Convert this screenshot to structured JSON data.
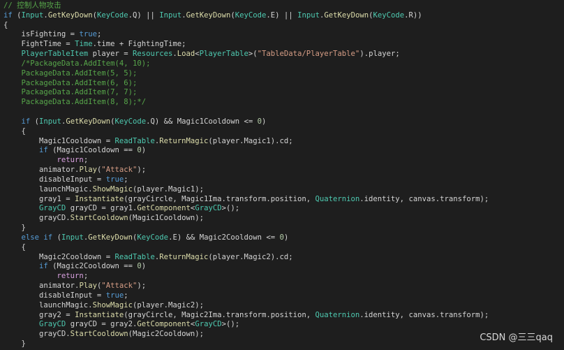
{
  "colors": {
    "background": "#1e1e1e",
    "plain": "#d4d4d4",
    "keyword": "#569cd6",
    "control": "#d8a0df",
    "type": "#4ec9b0",
    "method": "#dcdcaa",
    "string": "#d69d85",
    "number": "#b5cea8",
    "comment": "#57a64a",
    "field": "#dcdcdc"
  },
  "editor": {
    "lines": [
      [
        [
          "// 控制人物攻击",
          "comment"
        ]
      ],
      [
        [
          "if",
          "keyword"
        ],
        [
          " (",
          ""
        ],
        [
          "Input",
          "type"
        ],
        [
          ".",
          ""
        ],
        [
          "GetKeyDown",
          "method"
        ],
        [
          "(",
          ""
        ],
        [
          "KeyCode",
          "type"
        ],
        [
          ".Q) || ",
          ""
        ],
        [
          "Input",
          "type"
        ],
        [
          ".",
          ""
        ],
        [
          "GetKeyDown",
          "method"
        ],
        [
          "(",
          ""
        ],
        [
          "KeyCode",
          "type"
        ],
        [
          ".E) || ",
          ""
        ],
        [
          "Input",
          "type"
        ],
        [
          ".",
          ""
        ],
        [
          "GetKeyDown",
          "method"
        ],
        [
          "(",
          ""
        ],
        [
          "KeyCode",
          "type"
        ],
        [
          ".R))",
          ""
        ]
      ],
      [
        [
          "{",
          ""
        ]
      ],
      [
        [
          "    isFighting = ",
          ""
        ],
        [
          "true",
          "keyword"
        ],
        [
          ";",
          ""
        ]
      ],
      [
        [
          "    FightTime = ",
          ""
        ],
        [
          "Time",
          "type"
        ],
        [
          ".time + FightingTime;",
          ""
        ]
      ],
      [
        [
          "    ",
          ""
        ],
        [
          "PlayerTableItem",
          "type"
        ],
        [
          " player = ",
          ""
        ],
        [
          "Resources",
          "type"
        ],
        [
          ".",
          ""
        ],
        [
          "Load",
          "method"
        ],
        [
          "<",
          ""
        ],
        [
          "PlayerTable",
          "type"
        ],
        [
          ">(",
          ""
        ],
        [
          "\"TableData/PlayerTable\"",
          "string"
        ],
        [
          ").player;",
          ""
        ]
      ],
      [
        [
          "    /*PackageData.AddItem(4, 10);",
          "comment"
        ]
      ],
      [
        [
          "    PackageData.AddItem(5, 5);",
          "comment"
        ]
      ],
      [
        [
          "    PackageData.AddItem(6, 6);",
          "comment"
        ]
      ],
      [
        [
          "    PackageData.AddItem(7, 7);",
          "comment"
        ]
      ],
      [
        [
          "    PackageData.AddItem(8, 8);*/",
          "comment"
        ]
      ],
      [
        [
          "",
          ""
        ]
      ],
      [
        [
          "    ",
          ""
        ],
        [
          "if",
          "keyword"
        ],
        [
          " (",
          ""
        ],
        [
          "Input",
          "type"
        ],
        [
          ".",
          ""
        ],
        [
          "GetKeyDown",
          "method"
        ],
        [
          "(",
          ""
        ],
        [
          "KeyCode",
          "type"
        ],
        [
          ".Q) && Magic1Cooldown <= ",
          ""
        ],
        [
          "0",
          "number"
        ],
        [
          ")",
          ""
        ]
      ],
      [
        [
          "    {",
          ""
        ]
      ],
      [
        [
          "        Magic1Cooldown = ",
          ""
        ],
        [
          "ReadTable",
          "type"
        ],
        [
          ".",
          ""
        ],
        [
          "ReturnMagic",
          "method"
        ],
        [
          "(player.Magic1).cd;",
          ""
        ]
      ],
      [
        [
          "        ",
          ""
        ],
        [
          "if",
          "keyword"
        ],
        [
          " (Magic1Cooldown == ",
          ""
        ],
        [
          "0",
          "number"
        ],
        [
          ")",
          ""
        ]
      ],
      [
        [
          "            ",
          ""
        ],
        [
          "return",
          "control"
        ],
        [
          ";",
          ""
        ]
      ],
      [
        [
          "        animator.",
          ""
        ],
        [
          "Play",
          "method"
        ],
        [
          "(",
          ""
        ],
        [
          "\"Attack\"",
          "string"
        ],
        [
          ");",
          ""
        ]
      ],
      [
        [
          "        disableInput = ",
          ""
        ],
        [
          "true",
          "keyword"
        ],
        [
          ";",
          ""
        ]
      ],
      [
        [
          "        launchMagic.",
          ""
        ],
        [
          "ShowMagic",
          "method"
        ],
        [
          "(player.Magic1);",
          ""
        ]
      ],
      [
        [
          "        gray1 = ",
          ""
        ],
        [
          "Instantiate",
          "method"
        ],
        [
          "(grayCircle, Magic1Ima.transform.position, ",
          ""
        ],
        [
          "Quaternion",
          "type"
        ],
        [
          ".identity, canvas.transform);",
          ""
        ]
      ],
      [
        [
          "        ",
          ""
        ],
        [
          "GrayCD",
          "type"
        ],
        [
          " grayCD = gray1.",
          ""
        ],
        [
          "GetComponent",
          "method"
        ],
        [
          "<",
          ""
        ],
        [
          "GrayCD",
          "type"
        ],
        [
          ">();",
          ""
        ]
      ],
      [
        [
          "        grayCD.",
          ""
        ],
        [
          "StartCooldown",
          "method"
        ],
        [
          "(Magic1Cooldown);",
          ""
        ]
      ],
      [
        [
          "    }",
          ""
        ]
      ],
      [
        [
          "    ",
          ""
        ],
        [
          "else",
          "keyword"
        ],
        [
          " ",
          ""
        ],
        [
          "if",
          "keyword"
        ],
        [
          " (",
          ""
        ],
        [
          "Input",
          "type"
        ],
        [
          ".",
          ""
        ],
        [
          "GetKeyDown",
          "method"
        ],
        [
          "(",
          ""
        ],
        [
          "KeyCode",
          "type"
        ],
        [
          ".E) && Magic2Cooldown <= ",
          ""
        ],
        [
          "0",
          "number"
        ],
        [
          ")",
          ""
        ]
      ],
      [
        [
          "    {",
          ""
        ]
      ],
      [
        [
          "        Magic2Cooldown = ",
          ""
        ],
        [
          "ReadTable",
          "type"
        ],
        [
          ".",
          ""
        ],
        [
          "ReturnMagic",
          "method"
        ],
        [
          "(player.Magic2).cd;",
          ""
        ]
      ],
      [
        [
          "        ",
          ""
        ],
        [
          "if",
          "keyword"
        ],
        [
          " (Magic2Cooldown == ",
          ""
        ],
        [
          "0",
          "number"
        ],
        [
          ")",
          ""
        ]
      ],
      [
        [
          "            ",
          ""
        ],
        [
          "return",
          "control"
        ],
        [
          ";",
          ""
        ]
      ],
      [
        [
          "        animator.",
          ""
        ],
        [
          "Play",
          "method"
        ],
        [
          "(",
          ""
        ],
        [
          "\"Attack\"",
          "string"
        ],
        [
          ");",
          ""
        ]
      ],
      [
        [
          "        disableInput = ",
          ""
        ],
        [
          "true",
          "keyword"
        ],
        [
          ";",
          ""
        ]
      ],
      [
        [
          "        launchMagic.",
          ""
        ],
        [
          "ShowMagic",
          "method"
        ],
        [
          "(player.Magic2);",
          ""
        ]
      ],
      [
        [
          "        gray2 = ",
          ""
        ],
        [
          "Instantiate",
          "method"
        ],
        [
          "(grayCircle, Magic2Ima.transform.position, ",
          ""
        ],
        [
          "Quaternion",
          "type"
        ],
        [
          ".identity, canvas.transform);",
          ""
        ]
      ],
      [
        [
          "        ",
          ""
        ],
        [
          "GrayCD",
          "type"
        ],
        [
          " grayCD = gray2.",
          ""
        ],
        [
          "GetComponent",
          "method"
        ],
        [
          "<",
          ""
        ],
        [
          "GrayCD",
          "type"
        ],
        [
          ">();",
          ""
        ]
      ],
      [
        [
          "        grayCD.",
          ""
        ],
        [
          "StartCooldown",
          "method"
        ],
        [
          "(Magic2Cooldown);",
          ""
        ]
      ],
      [
        [
          "    }",
          ""
        ]
      ]
    ]
  },
  "watermark": "CSDN @三三qaq"
}
